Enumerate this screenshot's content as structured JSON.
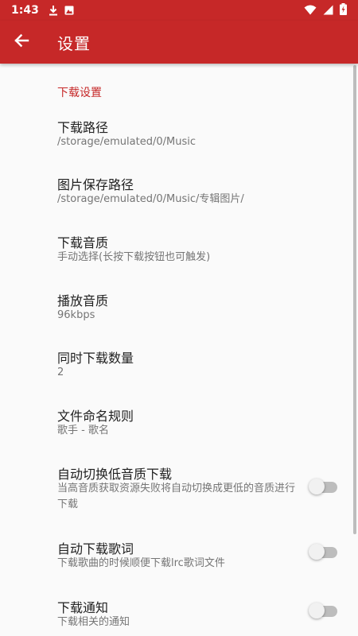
{
  "status_bar": {
    "time": "1:43",
    "icons": [
      "download-icon",
      "photo-icon",
      "wifi-icon",
      "signal-icon",
      "battery-charging-icon"
    ]
  },
  "app_bar": {
    "back_icon": "arrow-back-icon",
    "title": "设置"
  },
  "colors": {
    "primary": "#c62828",
    "background": "#fafafa",
    "title_text": "#212121",
    "summary_text": "#757575",
    "switch_off": "#bdbdbd"
  },
  "settings": {
    "section_title": "下载设置",
    "items": [
      {
        "title": "下载路径",
        "summary": "/storage/emulated/0/Music"
      },
      {
        "title": "图片保存路径",
        "summary": "/storage/emulated/0/Music/专辑图片/"
      },
      {
        "title": "下载音质",
        "summary": "手动选择(长按下载按钮也可触发)"
      },
      {
        "title": "播放音质",
        "summary": "96kbps"
      },
      {
        "title": "同时下载数量",
        "summary": "2"
      },
      {
        "title": "文件命名规则",
        "summary": "歌手 - 歌名"
      },
      {
        "title": "自动切换低音质下载",
        "summary": "当高音质获取资源失败将自动切换成更低的音质进行下载",
        "switch_on": false
      },
      {
        "title": "自动下载歌词",
        "summary": "下载歌曲的时候顺便下载lrc歌词文件",
        "switch_on": false
      },
      {
        "title": "下载通知",
        "summary": "下载相关的通知",
        "switch_on": false
      }
    ]
  }
}
